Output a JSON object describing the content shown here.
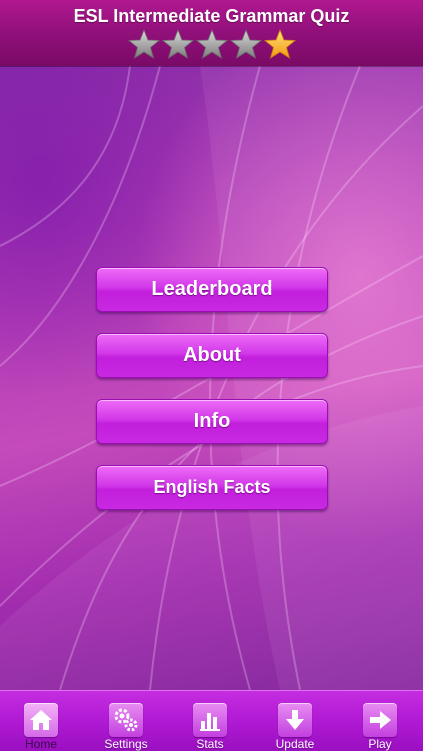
{
  "header": {
    "title": "ESL Intermediate Grammar Quiz",
    "rating": {
      "filled": 1,
      "total": 5
    }
  },
  "menu": {
    "leaderboard": "Leaderboard",
    "about": "About",
    "info": "Info",
    "english_facts": "English Facts"
  },
  "tabbar": {
    "active": "home",
    "home": "Home",
    "settings": "Settings",
    "stats": "Stats",
    "update": "Update",
    "play": "Play"
  },
  "colors": {
    "header": "#9a1283",
    "button": "#c829e2",
    "tabbar": "#b01ad4",
    "star_filled": "#f6a818",
    "star_empty": "#9a9a9a"
  }
}
